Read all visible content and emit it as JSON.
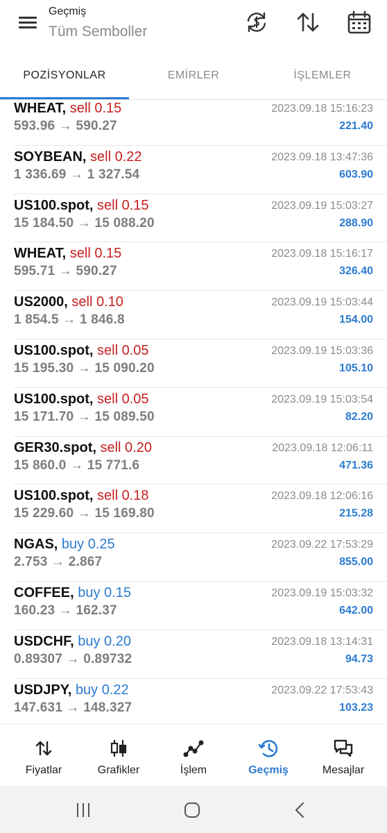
{
  "header": {
    "title_small": "Geçmiş",
    "title_big": "Tüm Semboller",
    "icons": [
      "menu-icon",
      "currency-exchange-icon",
      "sort-icon",
      "calendar-icon"
    ]
  },
  "tabs": [
    {
      "label": "POZİSYONLAR",
      "active": true
    },
    {
      "label": "EMİRLER",
      "active": false
    },
    {
      "label": "İŞLEMLER",
      "active": false
    }
  ],
  "colors": {
    "accent": "#2b7bd0",
    "sell": "#c62020",
    "buy": "#2b7bd0",
    "muted": "#8a8a8a"
  },
  "positions": [
    {
      "symbol": "WHEAT,",
      "side": "sell 0.15",
      "type": "sell",
      "prices": "593.96 → 590.27",
      "time": "2023.09.18 15:16:23",
      "profit": "221.40"
    },
    {
      "symbol": "SOYBEAN,",
      "side": "sell 0.22",
      "type": "sell",
      "prices": "1 336.69 → 1 327.54",
      "time": "2023.09.18 13:47:36",
      "profit": "603.90"
    },
    {
      "symbol": "US100.spot,",
      "side": "sell 0.15",
      "type": "sell",
      "prices": "15 184.50 → 15 088.20",
      "time": "2023.09.19 15:03:27",
      "profit": "288.90"
    },
    {
      "symbol": "WHEAT,",
      "side": "sell 0.15",
      "type": "sell",
      "prices": "595.71 → 590.27",
      "time": "2023.09.18 15:16:17",
      "profit": "326.40"
    },
    {
      "symbol": "US2000,",
      "side": "sell 0.10",
      "type": "sell",
      "prices": "1 854.5 → 1 846.8",
      "time": "2023.09.19 15:03:44",
      "profit": "154.00"
    },
    {
      "symbol": "US100.spot,",
      "side": "sell 0.05",
      "type": "sell",
      "prices": "15 195.30 → 15 090.20",
      "time": "2023.09.19 15:03:36",
      "profit": "105.10"
    },
    {
      "symbol": "US100.spot,",
      "side": "sell 0.05",
      "type": "sell",
      "prices": "15 171.70 → 15 089.50",
      "time": "2023.09.19 15:03:54",
      "profit": "82.20"
    },
    {
      "symbol": "GER30.spot,",
      "side": "sell 0.20",
      "type": "sell",
      "prices": "15 860.0 → 15 771.6",
      "time": "2023.09.18 12:06:11",
      "profit": "471.36"
    },
    {
      "symbol": "US100.spot,",
      "side": "sell 0.18",
      "type": "sell",
      "prices": "15 229.60 → 15 169.80",
      "time": "2023.09.18 12:06:16",
      "profit": "215.28"
    },
    {
      "symbol": "NGAS,",
      "side": "buy 0.25",
      "type": "buy",
      "prices": "2.753 → 2.867",
      "time": "2023.09.22 17:53:29",
      "profit": "855.00"
    },
    {
      "symbol": "COFFEE,",
      "side": "buy 0.15",
      "type": "buy",
      "prices": "160.23 → 162.37",
      "time": "2023.09.19 15:03:32",
      "profit": "642.00"
    },
    {
      "symbol": "USDCHF,",
      "side": "buy 0.20",
      "type": "buy",
      "prices": "0.89307 → 0.89732",
      "time": "2023.09.18 13:14:31",
      "profit": "94.73"
    },
    {
      "symbol": "USDJPY,",
      "side": "buy 0.22",
      "type": "buy",
      "prices": "147.631 → 148.327",
      "time": "2023.09.22 17:53:43",
      "profit": "103.23"
    }
  ],
  "bottom_nav": [
    {
      "label": "Fiyatlar",
      "icon": "quotes-icon",
      "active": false
    },
    {
      "label": "Grafikler",
      "icon": "candlestick-chart-icon",
      "active": false
    },
    {
      "label": "İşlem",
      "icon": "trade-line-icon",
      "active": false
    },
    {
      "label": "Geçmiş",
      "icon": "history-icon",
      "active": true
    },
    {
      "label": "Mesajlar",
      "icon": "messages-icon",
      "active": false
    }
  ],
  "system_bar": [
    "recent-apps-icon",
    "home-icon",
    "back-icon"
  ]
}
